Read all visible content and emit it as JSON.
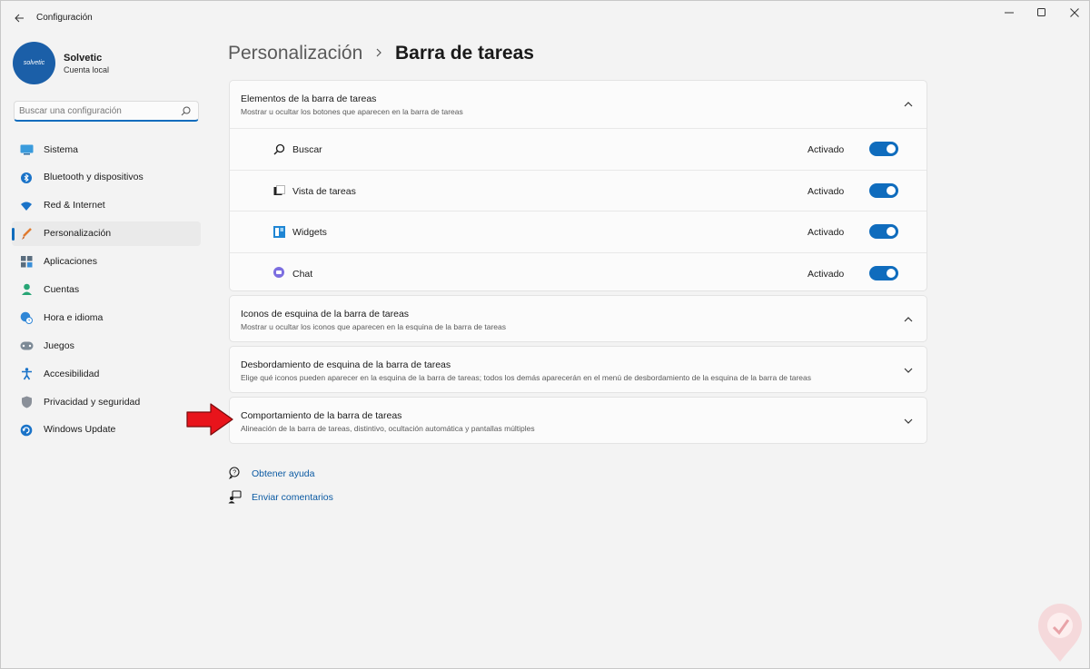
{
  "window": {
    "title": "Configuración"
  },
  "profile": {
    "avatar_text": "solvetic",
    "name": "Solvetic",
    "account_type": "Cuenta local"
  },
  "search": {
    "placeholder": "Buscar una configuración"
  },
  "sidebar": {
    "items": [
      {
        "label": "Sistema",
        "icon": "system-icon"
      },
      {
        "label": "Bluetooth y dispositivos",
        "icon": "bluetooth-icon"
      },
      {
        "label": "Red & Internet",
        "icon": "wifi-icon"
      },
      {
        "label": "Personalización",
        "icon": "brush-icon",
        "active": true
      },
      {
        "label": "Aplicaciones",
        "icon": "apps-icon"
      },
      {
        "label": "Cuentas",
        "icon": "person-icon"
      },
      {
        "label": "Hora e idioma",
        "icon": "globe-clock-icon"
      },
      {
        "label": "Juegos",
        "icon": "gamepad-icon"
      },
      {
        "label": "Accesibilidad",
        "icon": "accessibility-icon"
      },
      {
        "label": "Privacidad y seguridad",
        "icon": "shield-icon"
      },
      {
        "label": "Windows Update",
        "icon": "update-icon"
      }
    ]
  },
  "breadcrumb": {
    "parent": "Personalización",
    "current": "Barra de tareas"
  },
  "sections": {
    "taskbar_items": {
      "title": "Elementos de la barra de tareas",
      "description": "Mostrar u ocultar los botones que aparecen en la barra de tareas",
      "expanded": true,
      "rows": [
        {
          "label": "Buscar",
          "state": "Activado",
          "icon": "search-icon",
          "on": true
        },
        {
          "label": "Vista de tareas",
          "state": "Activado",
          "icon": "task-view-icon",
          "on": true
        },
        {
          "label": "Widgets",
          "state": "Activado",
          "icon": "widgets-icon",
          "on": true
        },
        {
          "label": "Chat",
          "state": "Activado",
          "icon": "chat-icon",
          "on": true
        }
      ]
    },
    "corner_icons": {
      "title": "Iconos de esquina de la barra de tareas",
      "description": "Mostrar u ocultar los iconos que aparecen en la esquina de la barra de tareas",
      "expanded": true
    },
    "corner_overflow": {
      "title": "Desbordamiento de esquina de la barra de tareas",
      "description": "Elige qué iconos pueden aparecer en la esquina de la barra de tareas; todos los demás aparecerán en el menú de desbordamiento de la esquina de la barra de tareas",
      "expanded": false
    },
    "behavior": {
      "title": "Comportamiento de la barra de tareas",
      "description": "Alineación de la barra de tareas, distintivo, ocultación automática y pantallas múltiples",
      "expanded": false
    }
  },
  "links": {
    "help": "Obtener ayuda",
    "feedback": "Enviar comentarios"
  },
  "colors": {
    "accent": "#0f6cbd",
    "arrow": "#e8141b"
  }
}
